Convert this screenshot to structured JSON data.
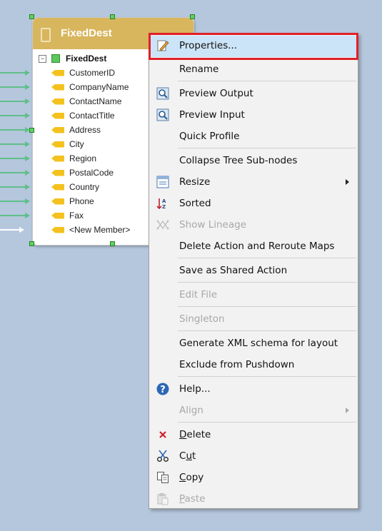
{
  "node": {
    "title": "FixedDest",
    "root_label": "FixedDest",
    "fields": [
      "CustomerID",
      "CompanyName",
      "ContactName",
      "ContactTitle",
      "Address",
      "City",
      "Region",
      "PostalCode",
      "Country",
      "Phone",
      "Fax",
      "<New Member>"
    ]
  },
  "menu": {
    "items": [
      {
        "label": "Properties...",
        "icon": "properties-icon",
        "highlighted": true
      },
      {
        "label": "Rename"
      },
      {
        "label": "Preview Output",
        "icon": "preview-output-icon"
      },
      {
        "label": "Preview Input",
        "icon": "preview-input-icon"
      },
      {
        "label": "Quick Profile"
      },
      {
        "label": "Collapse Tree Sub-nodes"
      },
      {
        "label": "Resize",
        "icon": "resize-icon",
        "submenu": true
      },
      {
        "label": "Sorted",
        "icon": "sort-icon"
      },
      {
        "label": "Show Lineage",
        "icon": "lineage-icon",
        "disabled": true
      },
      {
        "label": "Delete Action and Reroute Maps"
      },
      {
        "label": "Save as Shared Action"
      },
      {
        "label": "Edit File",
        "disabled": true
      },
      {
        "label": "Singleton",
        "disabled": true
      },
      {
        "label": "Generate XML schema for layout"
      },
      {
        "label": "Exclude from Pushdown"
      },
      {
        "label": "Help...",
        "icon": "help-icon"
      },
      {
        "label": "Align",
        "disabled": true,
        "submenu": true
      },
      {
        "label": "Delete",
        "icon": "delete-icon",
        "underline": "D"
      },
      {
        "label": "Cut",
        "icon": "cut-icon",
        "underline": "u"
      },
      {
        "label": "Copy",
        "icon": "copy-icon",
        "underline": "C"
      },
      {
        "label": "Paste",
        "icon": "paste-icon",
        "disabled": true,
        "underline": "P"
      }
    ]
  },
  "colors": {
    "canvas": "#b5c7dd",
    "node_header": "#d8b65e",
    "highlight": "#cce4f7",
    "focus_box": "#e0202a"
  }
}
